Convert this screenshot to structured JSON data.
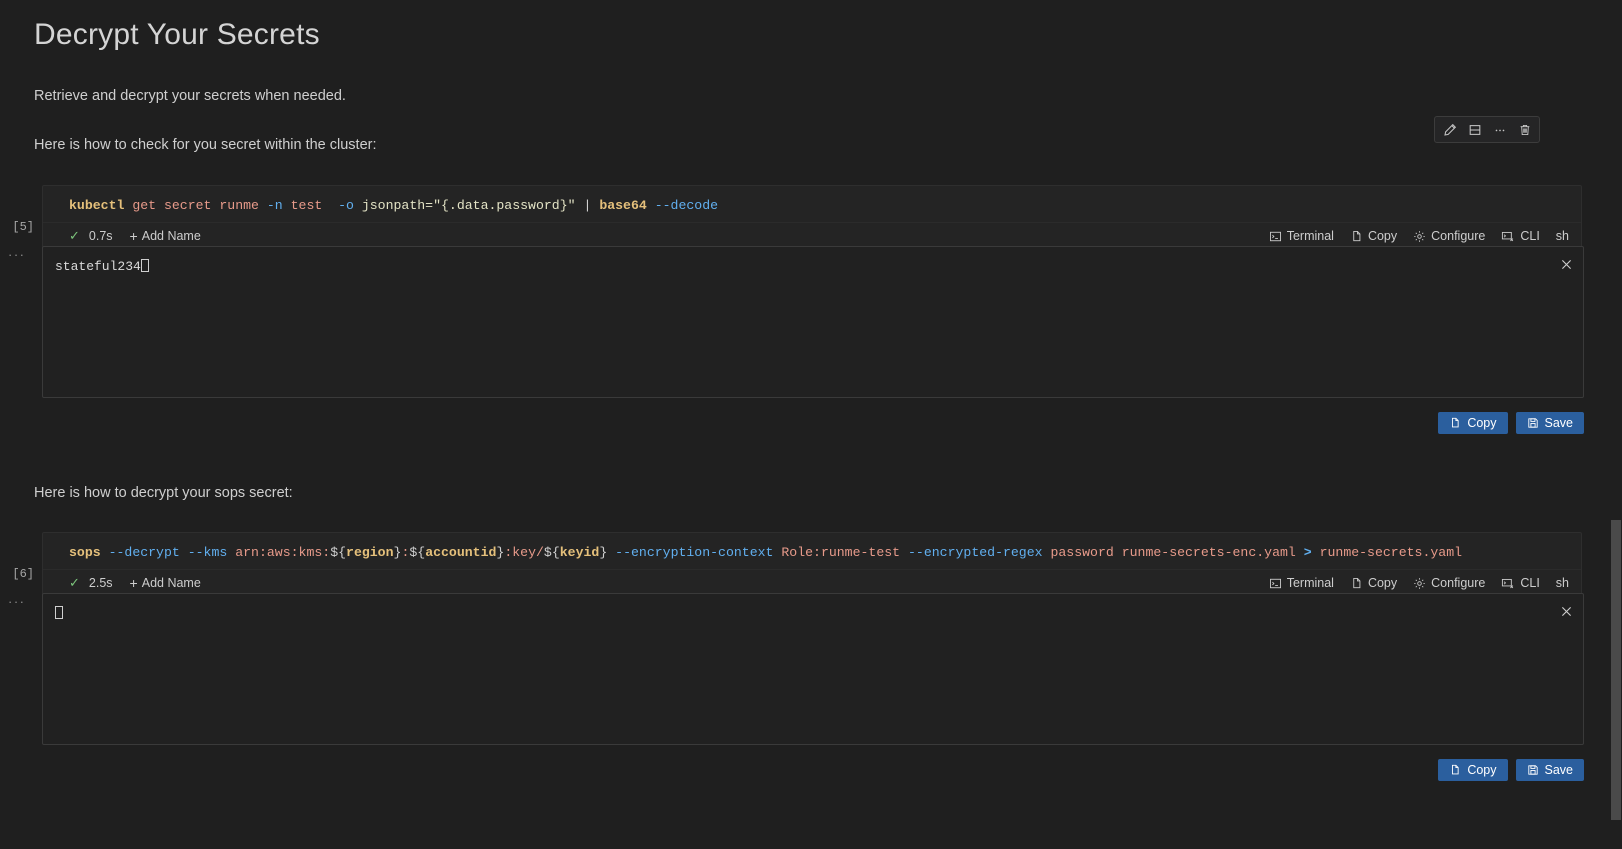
{
  "document": {
    "title": "Decrypt Your Secrets",
    "intro": "Retrieve and decrypt your secrets when needed.",
    "section1_label": "Here is how to check for you secret within the cluster:",
    "section2_label": "Here is how to decrypt your sops secret:"
  },
  "cell_toolbar": {
    "edit_icon": "pencil-icon",
    "split_icon": "split-cell-icon",
    "more_icon": "ellipsis-icon",
    "delete_icon": "trash-icon"
  },
  "cells": [
    {
      "exec_count": "[5]",
      "gutter_dots": "···",
      "command_plain": "kubectl get secret runme -n test  -o jsonpath=\"{.data.password}\" | base64 --decode",
      "command_tokens": [
        {
          "text": "kubectl",
          "cls": "t-cmd"
        },
        {
          "text": " ",
          "cls": "t-plain"
        },
        {
          "text": "get secret runme",
          "cls": "t-arg"
        },
        {
          "text": " ",
          "cls": "t-plain"
        },
        {
          "text": "-n",
          "cls": "t-flag"
        },
        {
          "text": " ",
          "cls": "t-plain"
        },
        {
          "text": "test",
          "cls": "t-arg"
        },
        {
          "text": "  ",
          "cls": "t-plain"
        },
        {
          "text": "-o",
          "cls": "t-flag"
        },
        {
          "text": " ",
          "cls": "t-plain"
        },
        {
          "text": "jsonpath=\"{.data.password}\"",
          "cls": "t-str"
        },
        {
          "text": " ",
          "cls": "t-plain"
        },
        {
          "text": "|",
          "cls": "t-punc"
        },
        {
          "text": " ",
          "cls": "t-plain"
        },
        {
          "text": "base64",
          "cls": "t-b64"
        },
        {
          "text": " ",
          "cls": "t-plain"
        },
        {
          "text": "--decode",
          "cls": "t-flag"
        }
      ],
      "status": {
        "check": "✓",
        "duration": "0.7s",
        "add_name": "Add Name",
        "add_name_plus": "+",
        "actions": [
          {
            "label": "Terminal",
            "icon": "terminal-icon"
          },
          {
            "label": "Copy",
            "icon": "copy-icon"
          },
          {
            "label": "Configure",
            "icon": "gear-icon"
          },
          {
            "label": "CLI",
            "icon": "cli-icon"
          },
          {
            "label": "sh",
            "icon": "none"
          }
        ]
      },
      "output": {
        "text": "stateful234",
        "has_cursor": true,
        "close_icon": "close-icon",
        "buttons": [
          {
            "label": "Copy",
            "icon": "copy-icon"
          },
          {
            "label": "Save",
            "icon": "save-icon"
          }
        ]
      }
    },
    {
      "exec_count": "[6]",
      "gutter_dots": "···",
      "command_plain": "sops --decrypt --kms arn:aws:kms:${region}:${accountid}:key/${keyid} --encryption-context Role:runme-test --encrypted-regex password runme-secrets-enc.yaml > runme-secrets.yaml",
      "command_tokens": [
        {
          "text": "sops",
          "cls": "t-cmd"
        },
        {
          "text": " ",
          "cls": "t-plain"
        },
        {
          "text": "--decrypt",
          "cls": "t-flag"
        },
        {
          "text": " ",
          "cls": "t-plain"
        },
        {
          "text": "--kms",
          "cls": "t-flag"
        },
        {
          "text": " ",
          "cls": "t-plain"
        },
        {
          "text": "arn:aws:kms:",
          "cls": "t-arg"
        },
        {
          "text": "${",
          "cls": "t-punc"
        },
        {
          "text": "region",
          "cls": "t-var"
        },
        {
          "text": "}",
          "cls": "t-punc"
        },
        {
          "text": ":",
          "cls": "t-arg"
        },
        {
          "text": "${",
          "cls": "t-punc"
        },
        {
          "text": "accountid",
          "cls": "t-var"
        },
        {
          "text": "}",
          "cls": "t-punc"
        },
        {
          "text": ":key/",
          "cls": "t-arg"
        },
        {
          "text": "${",
          "cls": "t-punc"
        },
        {
          "text": "keyid",
          "cls": "t-var"
        },
        {
          "text": "}",
          "cls": "t-punc"
        },
        {
          "text": " ",
          "cls": "t-plain"
        },
        {
          "text": "--encryption-context",
          "cls": "t-flag"
        },
        {
          "text": " ",
          "cls": "t-plain"
        },
        {
          "text": "Role:runme-test",
          "cls": "t-arg"
        },
        {
          "text": " ",
          "cls": "t-plain"
        },
        {
          "text": "--encrypted-regex",
          "cls": "t-flag"
        },
        {
          "text": " ",
          "cls": "t-plain"
        },
        {
          "text": "password runme-secrets-enc.yaml",
          "cls": "t-arg"
        },
        {
          "text": " ",
          "cls": "t-plain"
        },
        {
          "text": ">",
          "cls": "t-op"
        },
        {
          "text": " ",
          "cls": "t-plain"
        },
        {
          "text": "runme-secrets.yaml",
          "cls": "t-arg"
        }
      ],
      "status": {
        "check": "✓",
        "duration": "2.5s",
        "add_name": "Add Name",
        "add_name_plus": "+",
        "actions": [
          {
            "label": "Terminal",
            "icon": "terminal-icon"
          },
          {
            "label": "Copy",
            "icon": "copy-icon"
          },
          {
            "label": "Configure",
            "icon": "gear-icon"
          },
          {
            "label": "CLI",
            "icon": "cli-icon"
          },
          {
            "label": "sh",
            "icon": "none"
          }
        ]
      },
      "output": {
        "text": "",
        "has_cursor": true,
        "close_icon": "close-icon",
        "buttons": [
          {
            "label": "Copy",
            "icon": "copy-icon"
          },
          {
            "label": "Save",
            "icon": "save-icon"
          }
        ]
      }
    }
  ],
  "theme": {
    "background": "#1f1f1f",
    "code_background": "#242424",
    "output_background": "#212121",
    "accent_button": "#2b5f9e",
    "success_green": "#7cc47c",
    "text_primary": "#d4d4d4"
  }
}
